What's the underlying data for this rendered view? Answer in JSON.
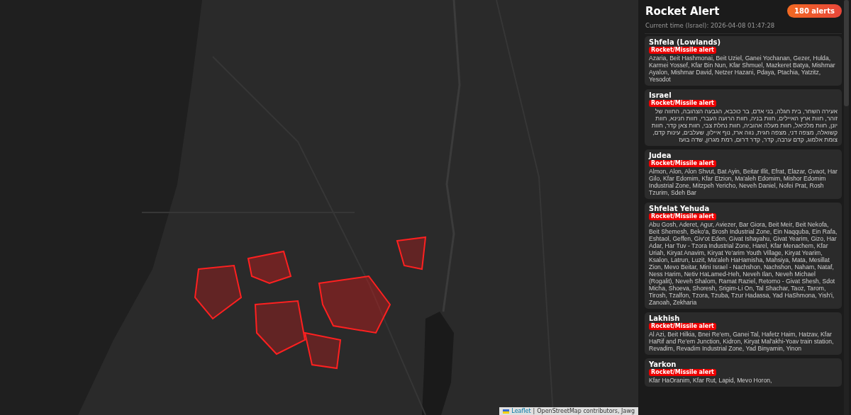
{
  "map": {
    "kind": "picture",
    "attribution": {
      "link": "Leaflet",
      "separator": "|",
      "text": "OpenStreetMap contributors, Jawg"
    }
  },
  "sidebar": {
    "title": "Rocket Alert",
    "count_badge": "180 alerts",
    "current_time": "Current time (Israel): 2026-04-08 01:47:28",
    "areas": [
      {
        "name": "Shfela (Lowlands)",
        "alert_type": "Rocket/Missile alert",
        "places": "Azaria, Beit Hashmonai, Beit Uziel, Ganei Yochanan, Gezer, Hulda, Karmei Yossef, Kfar Bin Nun, Kfar Shmuel, Mazkeret Batya, Mishmar Ayalon, Mishmar David, Netzer Hazani, Pdaya, Ptachia, Yatzitz, Yesodot"
      },
      {
        "name": "Israel",
        "alert_type": "Rocket/Missile alert",
        "places": "אעירה השחר, בית חגלה, בני אדם, בר כוכבא, הגבעה הצהובה, החווה של זוהר, חוות ארץ האיילים, חוות בניה, חוות הרועה העברי, חוות חנינא, חוות יונן, חוות מלכיאל, חוות מעלה אהוביה, חוות נחלת צבי, חוות צאן קדר, חוות קשואלה, מצפה דני, מצפה חגית, נווה ארז, נוף איילון, שעלבים, עינות קדם, צומת אלמוג, קדם ערבה, קדר, קדר דרום, רמת מגרון, שדה בועז"
      },
      {
        "name": "Judea",
        "alert_type": "Rocket/Missile alert",
        "places": "Almon, Alon, Alon Shvut, Bat Ayin, Beitar Illit, Efrat, Elazar, Gvaot, Har Gilo, Kfar Edomim, Kfar Etzion, Ma'aleh Edomim, Mishor Edomim Industrial Zone, Mitzpeh Yericho, Neveh Daniel, Nofei Prat, Rosh Tzurim, Sdeh Bar"
      },
      {
        "name": "Shfelat Yehuda",
        "alert_type": "Rocket/Missile alert",
        "places": "Abu Gosh, Aderet, Agur, Aviezer, Bar Giora, Beit Meir, Beit Nekofa, Beit Shemesh, Beko'a, Brosh Industrial Zone, Ein Naqquba, Ein Rafa, Eshtaol, Geffen, Giv'ot Eden, Givat Ishayahu, Givat Yearim, Gizo, Har Adar, Har Tuv - Tzora Industrial Zone, Harel, Kfar Menachem, Kfar Uriah, Kiryat Anavim, Kiryat Ye'arim Youth Village, Kiryat Yearim, Ksalon, Latrun, Luzit, Ma'aleh HaHamisha, Mahsiya, Mata, Mesillat Zion, Mevo Beitar, Mini Israel - Nachshon, Nachshon, Naham, Nataf, Ness Harim, Netiv HaLamed-Heh, Neveh Ilan, Neveh Michael (Rogalit), Neveh Shalom, Ramat Raziel, Retorno - Givat Shesh, Sdot Micha, Shoeva, Shoresh, Srigim-Li On, Tal Shachar, Taoz, Tarom, Tirosh, Tzalfon, Tzora, Tzuba, Tzur Hadassa, Yad HaShmona, Yish'i, Zanoah, Zekharia"
      },
      {
        "name": "Lakhish",
        "alert_type": "Rocket/Missile alert",
        "places": "Al Azi, Beit Hilkia, Bnei Re'em, Ganei Tal, Hafetz Haim, Hatzav, Kfar HaRif and Re'em Junction, Kidron, Kiryat Mal'akhi-Yoav train station, Revadim, Revadim Industrial Zone, Yad Binyamin, Yinon"
      },
      {
        "name": "Yarkon",
        "alert_type": "Rocket/Missile alert",
        "places": "Kfar HaOranim, Kfar Rut, Lapid, Mevo Horon,"
      }
    ]
  }
}
